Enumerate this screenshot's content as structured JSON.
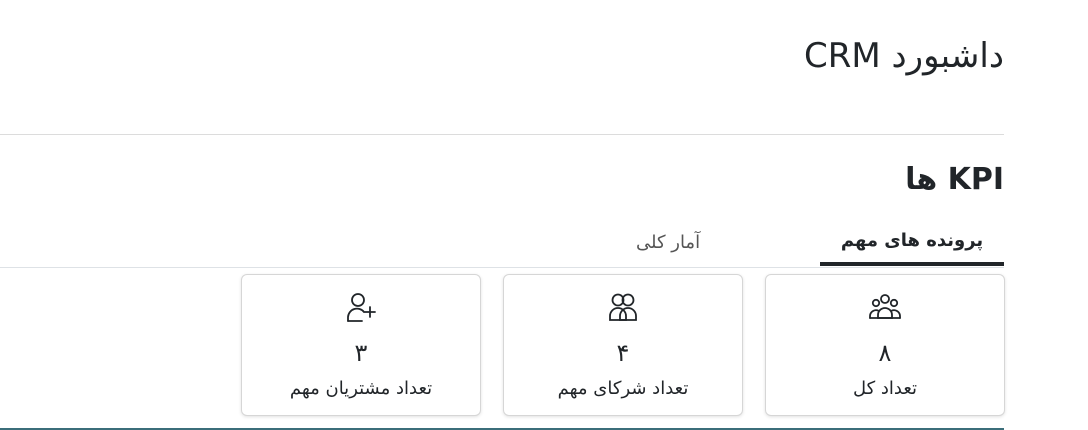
{
  "header": {
    "title": "داشبورد CRM"
  },
  "section": {
    "title": "KPI ها"
  },
  "tabs": [
    {
      "label": "آمار کلی",
      "active": false
    },
    {
      "label": "پرونده های مهم",
      "active": true
    }
  ],
  "cards": [
    {
      "icon": "users-group-icon",
      "value": "۸",
      "label": "تعداد کل"
    },
    {
      "icon": "partners-icon",
      "value": "۴",
      "label": "تعداد شرکای مهم"
    },
    {
      "icon": "user-plus-icon",
      "value": "۳",
      "label": "تعداد مشتریان مهم"
    }
  ],
  "colors": {
    "text": "#212529",
    "border": "#d6d6d6",
    "accent_bottom": "#3b6e7a"
  }
}
